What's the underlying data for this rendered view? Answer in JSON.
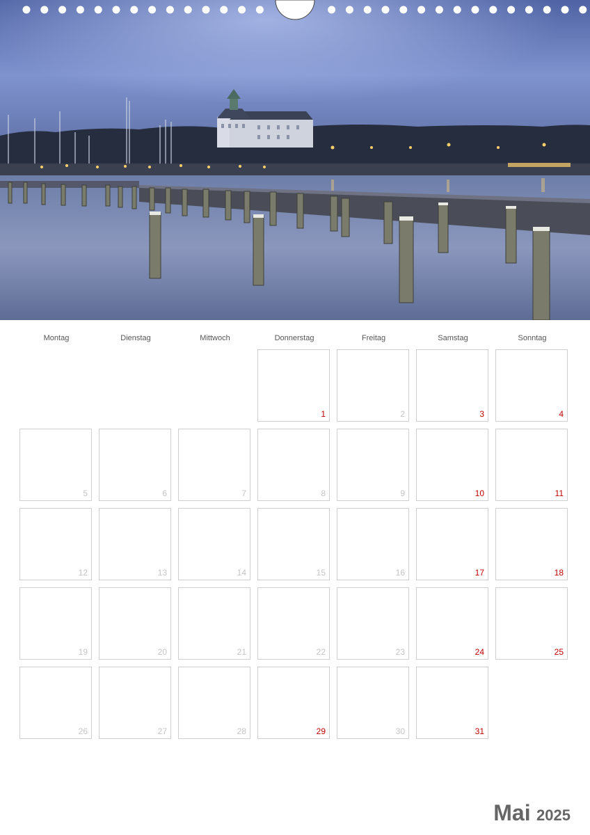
{
  "calendar": {
    "month": "Mai",
    "year": "2025",
    "weekdays": [
      "Montag",
      "Dienstag",
      "Mittwoch",
      "Donnerstag",
      "Freitag",
      "Samstag",
      "Sonntag"
    ],
    "start_weekday_index": 3,
    "days_in_month": 31,
    "highlighted_days": [
      1,
      3,
      4,
      10,
      11,
      17,
      18,
      24,
      25,
      29,
      31
    ]
  },
  "colors": {
    "highlight": "#c00000",
    "normal_day": "#c4c4c4",
    "cell_border": "#cfcfcf",
    "title": "#666666"
  },
  "photo": {
    "icons": [
      "harbor-photo",
      "castle-icon",
      "mooring-post-icon"
    ]
  }
}
